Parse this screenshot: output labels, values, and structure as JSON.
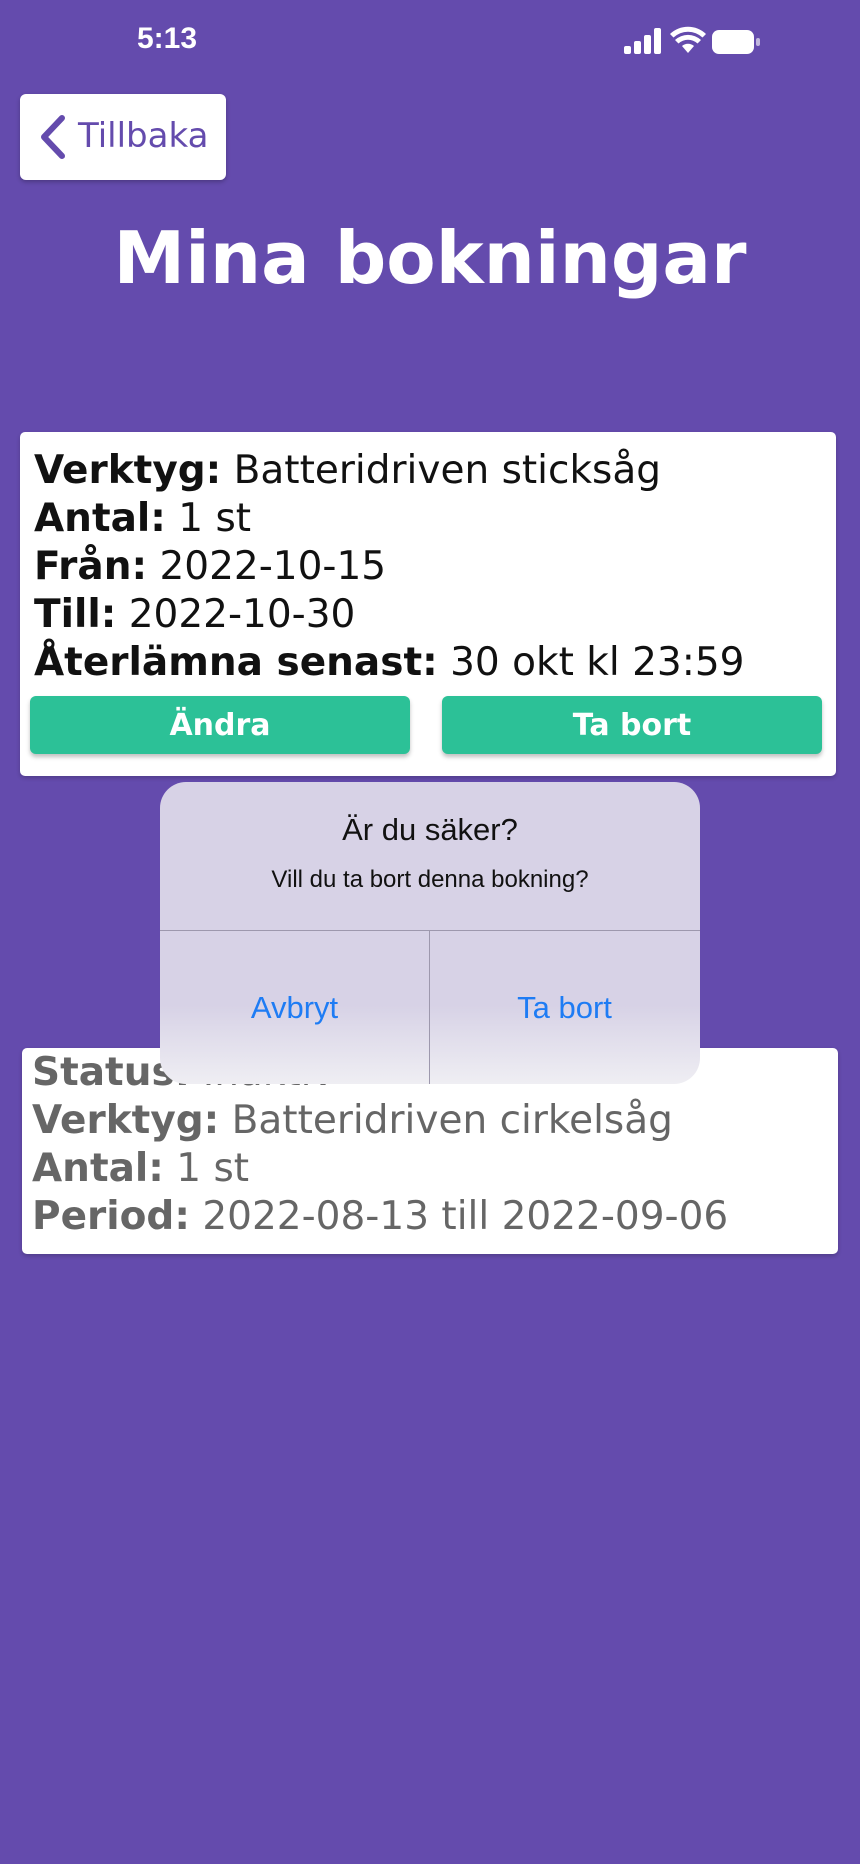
{
  "status_bar": {
    "time": "5:13"
  },
  "header": {
    "back_label": "Tillbaka",
    "title": "Mina bokningar"
  },
  "active_booking": {
    "tool_label": "Verktyg:",
    "tool_value": "Batteridriven sticksåg",
    "quantity_label": "Antal:",
    "quantity_value": "1 st",
    "from_label": "Från:",
    "from_value": "2022-10-15",
    "to_label": "Till:",
    "to_value": "2022-10-30",
    "return_label": "Återlämna senast:",
    "return_value": "30 okt kl 23:59",
    "edit_button": "Ändra",
    "delete_button": "Ta bort"
  },
  "dialog": {
    "title": "Är du säker?",
    "message": "Vill du ta bort denna bokning?",
    "cancel": "Avbryt",
    "confirm": "Ta bort"
  },
  "inactive_booking": {
    "status_label": "Status:",
    "status_value": "Inaktiv",
    "tool_label": "Verktyg:",
    "tool_value": "Batteridriven cirkelsåg",
    "quantity_label": "Antal:",
    "quantity_value": "1 st",
    "period_label": "Period:",
    "period_value": "2022-08-13 till 2022-09-06"
  },
  "colors": {
    "background": "#644bad",
    "button": "#2cc197",
    "alert_action": "#1e7cf4"
  },
  "icons": {
    "back": "chevron-left-icon",
    "signal": "cellular-signal-icon",
    "wifi": "wifi-icon",
    "battery": "battery-icon"
  }
}
